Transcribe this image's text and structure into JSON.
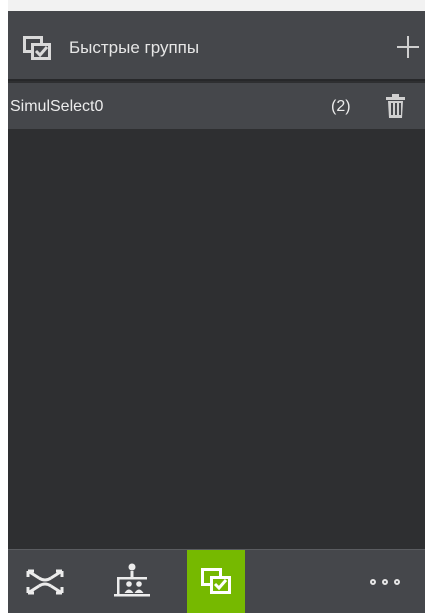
{
  "header": {
    "title": "Быстрые группы",
    "icon": "quick-groups-icon",
    "add_icon": "plus-icon"
  },
  "groups": [
    {
      "name": "SimulSelect0",
      "count": "(2)",
      "delete_icon": "trash-icon"
    }
  ],
  "toolbar": {
    "buttons": [
      {
        "icon": "fit-view-icon",
        "active": false
      },
      {
        "icon": "hierarchy-icon",
        "active": false
      },
      {
        "icon": "quick-groups-icon",
        "active": true
      },
      {
        "icon": "more-icon",
        "active": false
      }
    ]
  },
  "colors": {
    "panel_bg": "#2e2f31",
    "header_bg": "#45474b",
    "accent": "#76b900",
    "text": "#e6e6e6"
  }
}
